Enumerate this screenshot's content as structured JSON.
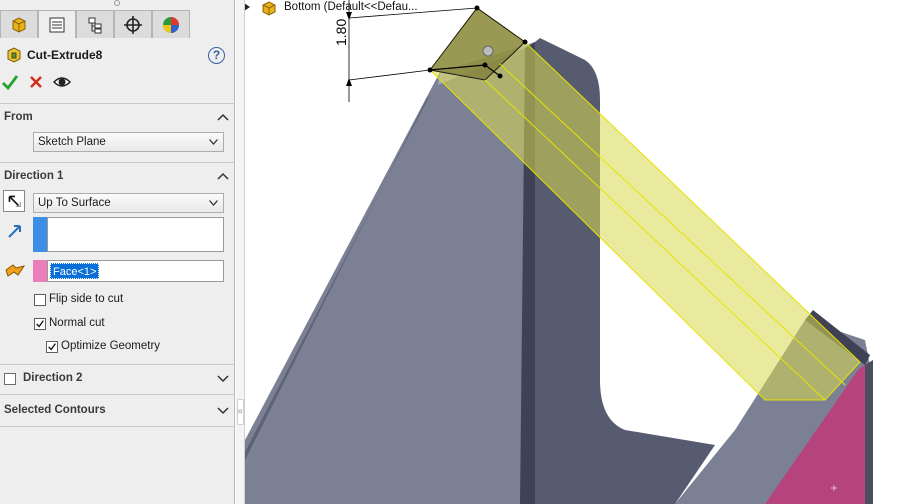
{
  "feature": {
    "title": "Cut-Extrude8",
    "help": "?"
  },
  "tabs": [
    {
      "icon": "feature-manager-icon"
    },
    {
      "icon": "property-manager-icon"
    },
    {
      "icon": "configuration-manager-icon"
    },
    {
      "icon": "dimxpert-manager-icon"
    },
    {
      "icon": "display-manager-icon"
    }
  ],
  "actions": {
    "ok": "ok-icon",
    "cancel": "cancel-icon",
    "preview": "preview-icon"
  },
  "from": {
    "label": "From",
    "value": "Sketch Plane"
  },
  "direction1": {
    "label": "Direction 1",
    "end_condition": "Up To Surface",
    "direction_value": "",
    "face_selection": "Face<1>",
    "flip_side": {
      "label": "Flip side to cut",
      "checked": false
    },
    "normal_cut": {
      "label": "Normal cut",
      "checked": true
    },
    "optimize_geometry": {
      "label": "Optimize Geometry",
      "checked": true
    }
  },
  "direction2": {
    "label": "Direction 2",
    "checked": false
  },
  "selected_contours": {
    "label": "Selected Contours"
  },
  "viewport": {
    "tree_text": "Bottom  (Default<<Defau...",
    "dimension": "1.80"
  },
  "colors": {
    "accent_blue": "#0a6fd6",
    "preview_yellow": "#d9d94f",
    "part_gray": "#7b7f93",
    "face_pink": "#b5447c"
  }
}
